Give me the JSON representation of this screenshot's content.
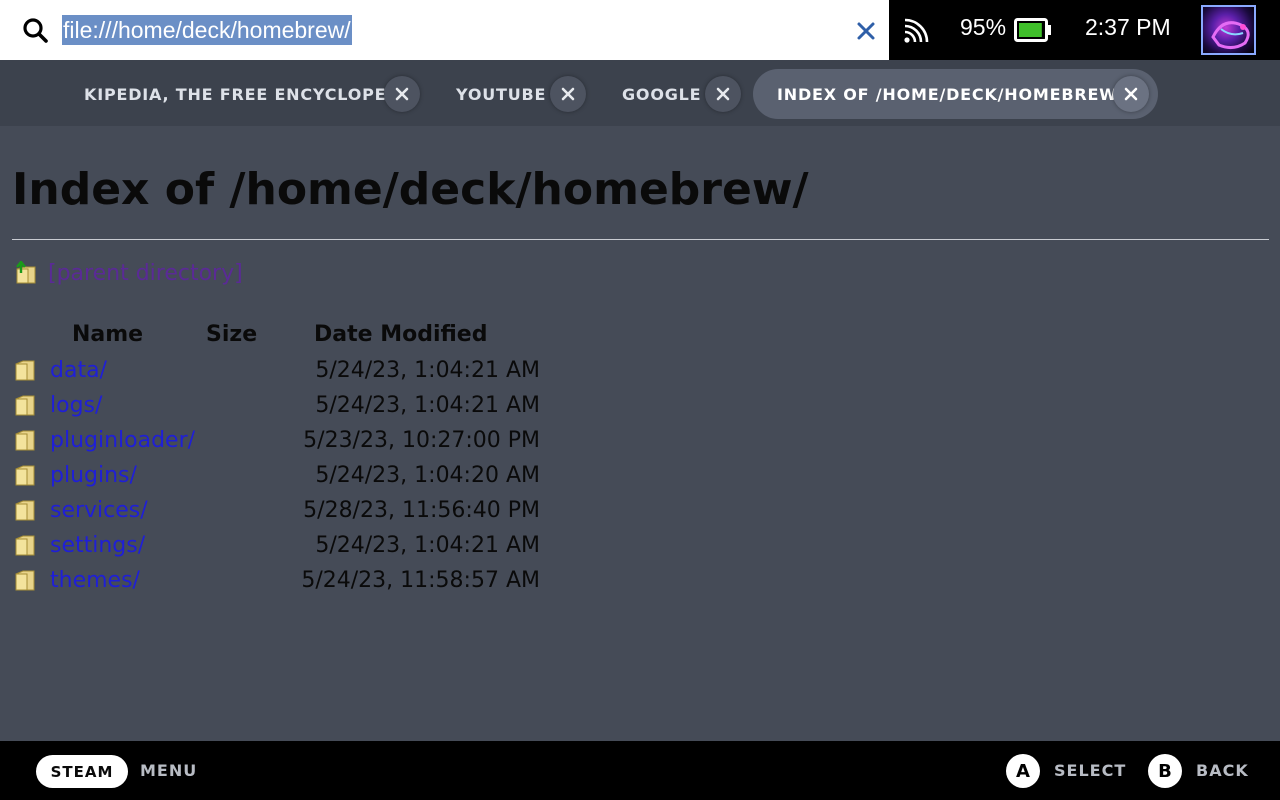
{
  "urlbar": {
    "url": "file:///home/deck/homebrew/"
  },
  "status": {
    "battery_percent": "95%",
    "battery_level": 0.95,
    "time": "2:37 PM"
  },
  "tabs": [
    {
      "label": "KIPEDIA, THE FREE ENCYCLOPED",
      "active": false
    },
    {
      "label": "YOUTUBE",
      "active": false
    },
    {
      "label": "GOOGLE",
      "active": false
    },
    {
      "label": "INDEX OF /HOME/DECK/HOMEBREW/",
      "active": true
    }
  ],
  "page": {
    "title": "Index of /home/deck/homebrew/",
    "parent_link": "[parent directory]",
    "columns": {
      "name": "Name",
      "size": "Size",
      "date": "Date Modified"
    },
    "entries": [
      {
        "name": "data/",
        "size": "",
        "date": "5/24/23, 1:04:21 AM"
      },
      {
        "name": "logs/",
        "size": "",
        "date": "5/24/23, 1:04:21 AM"
      },
      {
        "name": "pluginloader/",
        "size": "",
        "date": "5/23/23, 10:27:00 PM"
      },
      {
        "name": "plugins/",
        "size": "",
        "date": "5/24/23, 1:04:20 AM"
      },
      {
        "name": "services/",
        "size": "",
        "date": "5/28/23, 11:56:40 PM"
      },
      {
        "name": "settings/",
        "size": "",
        "date": "5/24/23, 1:04:21 AM"
      },
      {
        "name": "themes/",
        "size": "",
        "date": "5/24/23, 11:58:57 AM"
      }
    ]
  },
  "bottombar": {
    "steam_label": "STEAM",
    "menu_label": "MENU",
    "a_glyph": "A",
    "select_label": "SELECT",
    "b_glyph": "B",
    "back_label": "BACK"
  },
  "icons": {
    "search": "search-icon",
    "clear": "close-icon",
    "cast": "cast-icon",
    "battery": "battery-icon",
    "folder": "folder-icon",
    "parent": "folder-up-icon",
    "tab_close": "close-icon"
  },
  "colors": {
    "link": "#1f1fd6",
    "visited_link": "#5a2a96",
    "url_highlight": "#6b8fc6",
    "battery_fill": "#3fbf2a"
  }
}
